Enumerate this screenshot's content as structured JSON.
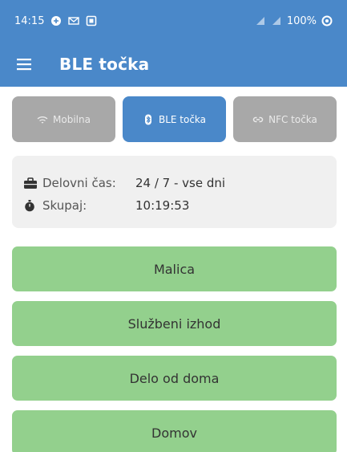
{
  "status_bar": {
    "time": "14:15",
    "battery": "100%"
  },
  "app_bar": {
    "title": "BLE točka",
    "menu_icon": "hamburger-menu-icon"
  },
  "tabs": [
    {
      "label": "Mobilna",
      "icon": "wifi-icon",
      "active": false
    },
    {
      "label": "BLE točka",
      "icon": "bluetooth-icon",
      "active": true
    },
    {
      "label": "NFC točka",
      "icon": "nfc-link-icon",
      "active": false
    }
  ],
  "info": {
    "work_time_label": "Delovni čas:",
    "work_time_value": "24 / 7 - vse dni",
    "total_label": "Skupaj:",
    "total_value": "10:19:53"
  },
  "actions": [
    {
      "label": "Malica"
    },
    {
      "label": "Službeni izhod"
    },
    {
      "label": "Delo od doma"
    },
    {
      "label": "Domov"
    }
  ],
  "colors": {
    "primary": "#4a88c9",
    "tab_inactive": "#a8a8a8",
    "action_green": "#93d08d",
    "info_bg": "#f0f0f0"
  }
}
